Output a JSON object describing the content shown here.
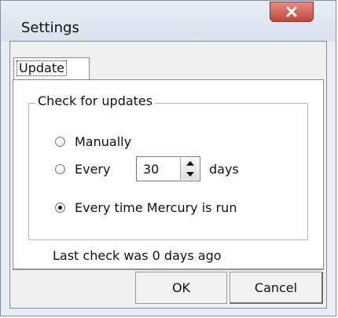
{
  "window": {
    "title": "Settings",
    "close_icon": "close-icon"
  },
  "tabs": [
    {
      "label": "Update",
      "selected": true
    }
  ],
  "update": {
    "group_title": "Check for updates",
    "options": [
      {
        "label": "Manually",
        "checked": false
      },
      {
        "label": "Every",
        "checked": false
      },
      {
        "label": "Every time Mercury is run",
        "checked": true
      }
    ],
    "interval_value": "30",
    "interval_unit": "days",
    "last_check": "Last check was 0 days ago"
  },
  "buttons": {
    "ok": "OK",
    "cancel": "Cancel"
  },
  "colors": {
    "close_button": "#c1473a",
    "window_frame": "#e9eef5"
  }
}
